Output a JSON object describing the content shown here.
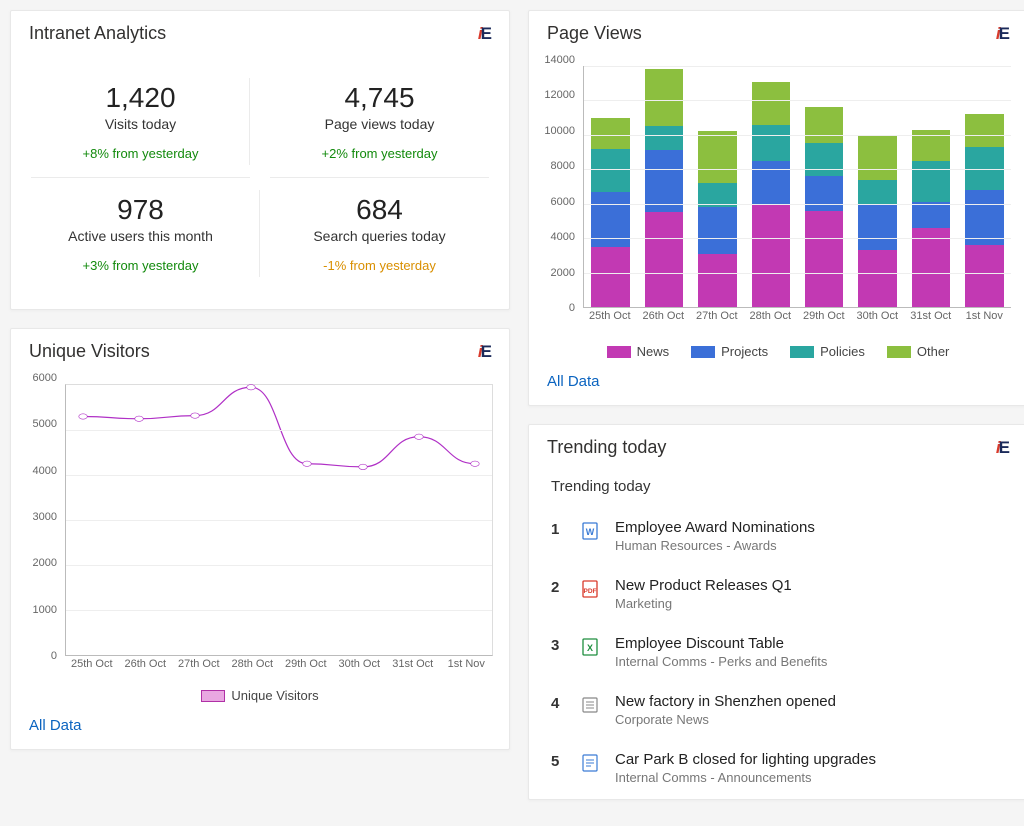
{
  "analytics_card": {
    "title": "Intranet Analytics",
    "metrics": [
      {
        "value": "1,420",
        "label": "Visits today",
        "change": "+8% from yesterday",
        "dir": "pos"
      },
      {
        "value": "4,745",
        "label": "Page views today",
        "change": "+2% from yesterday",
        "dir": "pos"
      },
      {
        "value": "978",
        "label": "Active users this month",
        "change": "+3% from yesterday",
        "dir": "pos"
      },
      {
        "value": "684",
        "label": "Search queries today",
        "change": "-1% from yesterday",
        "dir": "neg"
      }
    ]
  },
  "visitors_card": {
    "title": "Unique Visitors",
    "legend": "Unique Visitors",
    "all_data": "All Data"
  },
  "pageviews_card": {
    "title": "Page Views",
    "all_data": "All Data",
    "legend": {
      "news": "News",
      "projects": "Projects",
      "policies": "Policies",
      "other": "Other"
    }
  },
  "trending_card": {
    "title": "Trending today",
    "subtitle": "Trending today",
    "items": [
      {
        "rank": "1",
        "icon": "word",
        "title": "Employee Award Nominations",
        "meta": "Human Resources - Awards"
      },
      {
        "rank": "2",
        "icon": "pdf",
        "title": "New Product Releases Q1",
        "meta": "Marketing"
      },
      {
        "rank": "3",
        "icon": "excel",
        "title": "Employee Discount Table",
        "meta": "Internal Comms - Perks and Benefits"
      },
      {
        "rank": "4",
        "icon": "news",
        "title": "New factory in Shenzhen opened",
        "meta": "Corporate News"
      },
      {
        "rank": "5",
        "icon": "note",
        "title": "Car Park B closed for lighting upgrades",
        "meta": "Internal Comms - Announcements"
      }
    ]
  },
  "chart_data": [
    {
      "id": "visitors",
      "type": "line",
      "title": "Unique Visitors",
      "categories": [
        "25th Oct",
        "26th Oct",
        "27th Oct",
        "28th Oct",
        "29th Oct",
        "30th Oct",
        "31st Oct",
        "1st Nov"
      ],
      "series": [
        {
          "name": "Unique Visitors",
          "values": [
            5300,
            5250,
            5320,
            5950,
            4250,
            4180,
            4850,
            4250
          ]
        }
      ],
      "ylim": [
        0,
        6000
      ],
      "yticks": [
        0,
        1000,
        2000,
        3000,
        4000,
        5000,
        6000
      ]
    },
    {
      "id": "pageviews",
      "type": "bar",
      "stacked": true,
      "title": "Page Views",
      "categories": [
        "25th Oct",
        "26th Oct",
        "27th Oct",
        "28th Oct",
        "29th Oct",
        "30th Oct",
        "31st Oct",
        "1st Nov"
      ],
      "series": [
        {
          "name": "News",
          "color": "#c239b3",
          "values": [
            3500,
            5500,
            3100,
            5900,
            5600,
            3300,
            4600,
            3600
          ]
        },
        {
          "name": "Projects",
          "color": "#3b6fd8",
          "values": [
            3200,
            3600,
            2700,
            2600,
            2000,
            2700,
            1500,
            3200
          ]
        },
        {
          "name": "Policies",
          "color": "#2aa6a0",
          "values": [
            2500,
            1400,
            1400,
            2100,
            1900,
            1400,
            2400,
            2500
          ]
        },
        {
          "name": "Other",
          "color": "#8cbf3f",
          "values": [
            1800,
            3300,
            3000,
            2500,
            2100,
            2600,
            1800,
            1900
          ]
        }
      ],
      "ylim": [
        0,
        14000
      ],
      "yticks": [
        0,
        2000,
        4000,
        6000,
        8000,
        10000,
        12000,
        14000
      ]
    }
  ]
}
